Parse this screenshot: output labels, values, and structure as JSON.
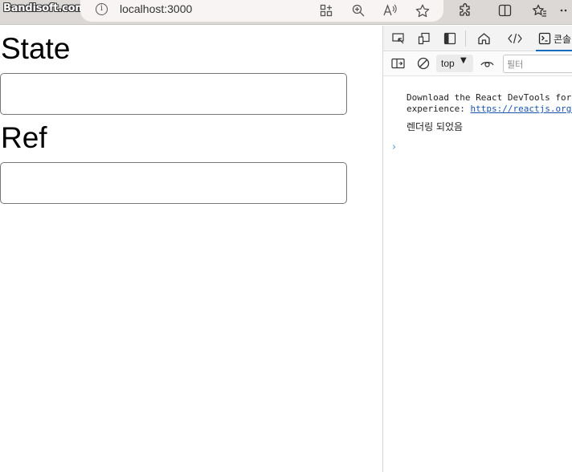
{
  "browser": {
    "watermark": "Bandisoft.com",
    "url": "localhost:3000",
    "toolbar_icons": [
      "info-icon",
      "apps-icon",
      "zoom-icon",
      "read-aloud-icon",
      "favorite-star-icon",
      "extensions-icon",
      "split-screen-icon",
      "favorites-icon"
    ]
  },
  "page": {
    "state_heading": "State",
    "state_input_value": "",
    "ref_heading": "Ref",
    "ref_input_value": ""
  },
  "devtools": {
    "tab_icons": [
      "inspect-icon",
      "device-emulation-icon",
      "dock-icon",
      "welcome-home-icon",
      "elements-icon",
      "console-icon"
    ],
    "console_tab_label": "콘솔",
    "context_label": "top",
    "filter_placeholder": "필터",
    "messages": {
      "react_line1": "Download the React DevTools for",
      "react_line2_prefix": "experience: ",
      "react_link": "https://reactjs.org/",
      "render_log": "렌더링 되었음"
    }
  },
  "colors": {
    "accent": "#0f6cbd",
    "link": "#1a55b0",
    "topbar": "#dcd8d6"
  }
}
